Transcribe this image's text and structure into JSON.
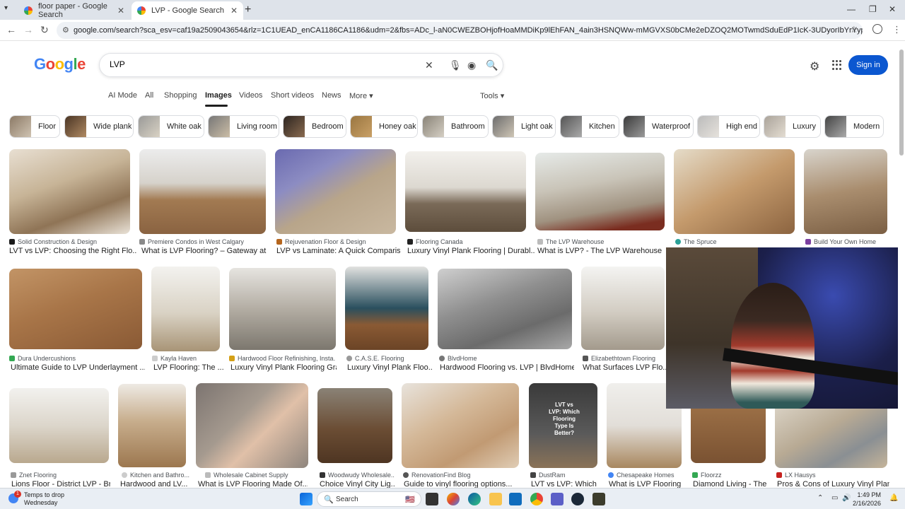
{
  "browser": {
    "tabs": [
      {
        "title": "floor paper - Google Search",
        "active": false
      },
      {
        "title": "LVP - Google Search",
        "active": true
      }
    ],
    "url": "google.com/search?sca_esv=caf19a2509043654&rlz=1C1UEAD_enCA1186CA1186&udm=2&fbs=ADc_l-aN0CWEZBOHjofHoaMMDiKp9lEhFAN_4ain3HSNQWw-mMGVXS0bCMe2eDZOQ2MOTwmdSduEdP1IcK-3UDyorIbYrYypmw2ykxY_-AvoMYwpWYTdBoJYNvh3R..."
  },
  "header": {
    "logo": [
      "G",
      "o",
      "o",
      "g",
      "l",
      "e"
    ],
    "query": "LVP",
    "signin": "Sign in"
  },
  "modes": [
    "AI Mode",
    "All",
    "Shopping",
    "Images",
    "Videos",
    "Short videos",
    "News",
    "More",
    "Tools"
  ],
  "chips": [
    "Floor",
    "Wide plank",
    "White oak",
    "Living room",
    "Bedroom",
    "Honey oak",
    "Bathroom",
    "Light oak",
    "Kitchen",
    "Waterproof",
    "High end",
    "Luxury",
    "Modern"
  ],
  "results": [
    {
      "source": "Solid Construction & Design",
      "title": "LVT vs LVP: Choosing the Right Flo..."
    },
    {
      "source": "Premiere Condos in West Calgary",
      "title": "What is LVP Flooring? – Gateway at ..."
    },
    {
      "source": "Rejuvenation Floor & Design",
      "title": "LVP vs Laminate: A Quick Comparison"
    },
    {
      "source": "Flooring Canada",
      "title": "Luxury Vinyl Plank Flooring | Durabl..."
    },
    {
      "source": "The LVP Warehouse",
      "title": "What is LVP? - The LVP Warehouse"
    },
    {
      "source": "The Spruce",
      "title": ""
    },
    {
      "source": "Build Your Own Home",
      "title": ""
    },
    {
      "source": "Dura Undercushions",
      "title": "Ultimate Guide to LVP Underlayment ..."
    },
    {
      "source": "Kayla Haven",
      "title": "LVP Flooring: The ..."
    },
    {
      "source": "Hardwood Floor Refinishing, Insta...",
      "title": "Luxury Vinyl Plank Flooring Gra..."
    },
    {
      "source": "C.A.S.E. Flooring",
      "title": "Luxury Vinyl Plank Floo..."
    },
    {
      "source": "BlvdHome",
      "title": "Hardwood Flooring vs. LVP | BlvdHome"
    },
    {
      "source": "Elizabethtown Flooring",
      "title": "What Surfaces LVP Flo..."
    },
    {
      "source": "Znet Flooring",
      "title": "Lions Floor - District LVP - Br..."
    },
    {
      "source": "Kitchen and Bathro...",
      "title": "Hardwood and LV..."
    },
    {
      "source": "Wholesale Cabinet Supply",
      "title": "What is LVP Flooring Made Of..."
    },
    {
      "source": "Woodwudy Wholesale...",
      "title": "Choice Vinyl City Lig..."
    },
    {
      "source": "RenovationFind Blog",
      "title": "Guide to vinyl flooring options..."
    },
    {
      "source": "DustRam",
      "title": "LVT vs LVP: Which ..."
    },
    {
      "source": "Chesapeake Homes",
      "title": "What is LVP Flooring ..."
    },
    {
      "source": "Floorzz",
      "title": "Diamond Living - The ..."
    },
    {
      "source": "LX Hausys",
      "title": "Pros & Cons of Luxury Vinyl Plan..."
    }
  ],
  "thumb_text": "LVT vs LVP: Which Flooring Type Is Better?",
  "taskbar": {
    "weather_title": "Temps to drop",
    "weather_sub": "Wednesday",
    "weather_badge": "1",
    "search": "Search",
    "time": "1:49 PM",
    "date": "2/16/2026"
  }
}
